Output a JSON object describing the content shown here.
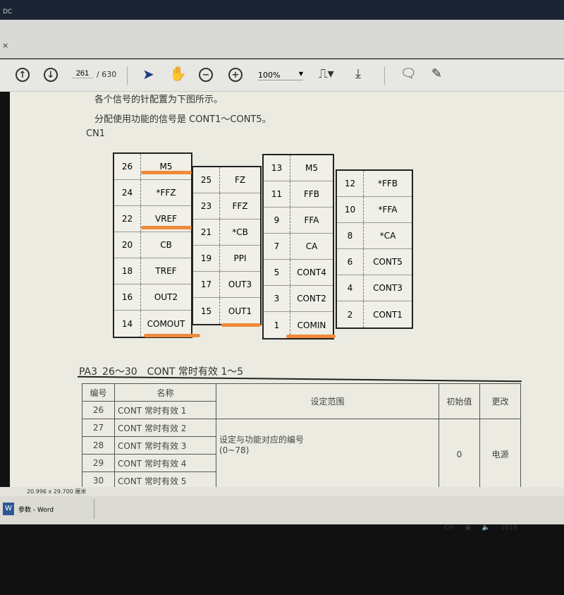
{
  "window": {
    "title": "DC",
    "close": "×"
  },
  "toolbar": {
    "page_current": "261",
    "page_total": "/ 630",
    "zoom": "100%",
    "icons": [
      "arrow-up-circle",
      "arrow-down-circle",
      "select-arrow",
      "hand",
      "zoom-out",
      "zoom-in",
      "fit-page",
      "scroll-mode",
      "comment",
      "highlight-pen"
    ]
  },
  "doc": {
    "line1": "各个信号的针配置为下图所示。",
    "line2": "分配使用功能的信号是 CONT1～CONT5。",
    "connector": "CN1",
    "pins": [
      [
        [
          "26",
          "M5"
        ],
        [
          "24",
          "*FFZ"
        ],
        [
          "22",
          "VREF"
        ],
        [
          "20",
          "CB"
        ],
        [
          "18",
          "TREF"
        ],
        [
          "16",
          "OUT2"
        ],
        [
          "14",
          "COMOUT"
        ]
      ],
      [
        [
          "25",
          "FZ"
        ],
        [
          "23",
          "FFZ"
        ],
        [
          "21",
          "*CB"
        ],
        [
          "19",
          "PPI"
        ],
        [
          "17",
          "OUT3"
        ],
        [
          "15",
          "OUT1"
        ]
      ],
      [
        [
          "13",
          "M5"
        ],
        [
          "11",
          "FFB"
        ],
        [
          "9",
          "FFA"
        ],
        [
          "7",
          "CA"
        ],
        [
          "5",
          "CONT4"
        ],
        [
          "3",
          "CONT2"
        ],
        [
          "1",
          "COMIN"
        ]
      ],
      [
        [
          "12",
          "*FFB"
        ],
        [
          "10",
          "*FFA"
        ],
        [
          "8",
          "*CA"
        ],
        [
          "6",
          "CONT5"
        ],
        [
          "4",
          "CONT3"
        ],
        [
          "2",
          "CONT1"
        ]
      ]
    ],
    "highlight_color": "#f08a3a",
    "section_title": "PA3_26～30　CONT 常时有效 1～5",
    "table": {
      "headers": [
        "编号",
        "名称",
        "设定范围",
        "初始值",
        "更改"
      ],
      "rows": [
        [
          "26",
          "CONT 常时有效 1"
        ],
        [
          "27",
          "CONT 常时有效 2"
        ],
        [
          "28",
          "CONT 常时有效 3"
        ],
        [
          "29",
          "CONT 常时有效 4"
        ],
        [
          "30",
          "CONT 常时有效 5"
        ]
      ],
      "range": "设定与功能对应的编号",
      "range2": "(0~78)",
      "initial": "0",
      "change": "电源"
    }
  },
  "status": {
    "page_size": "20.996 x 29.700 厘米"
  },
  "taskbar": {
    "word_item": "参数 - Word",
    "ime": "CH",
    "clock": "2019"
  }
}
